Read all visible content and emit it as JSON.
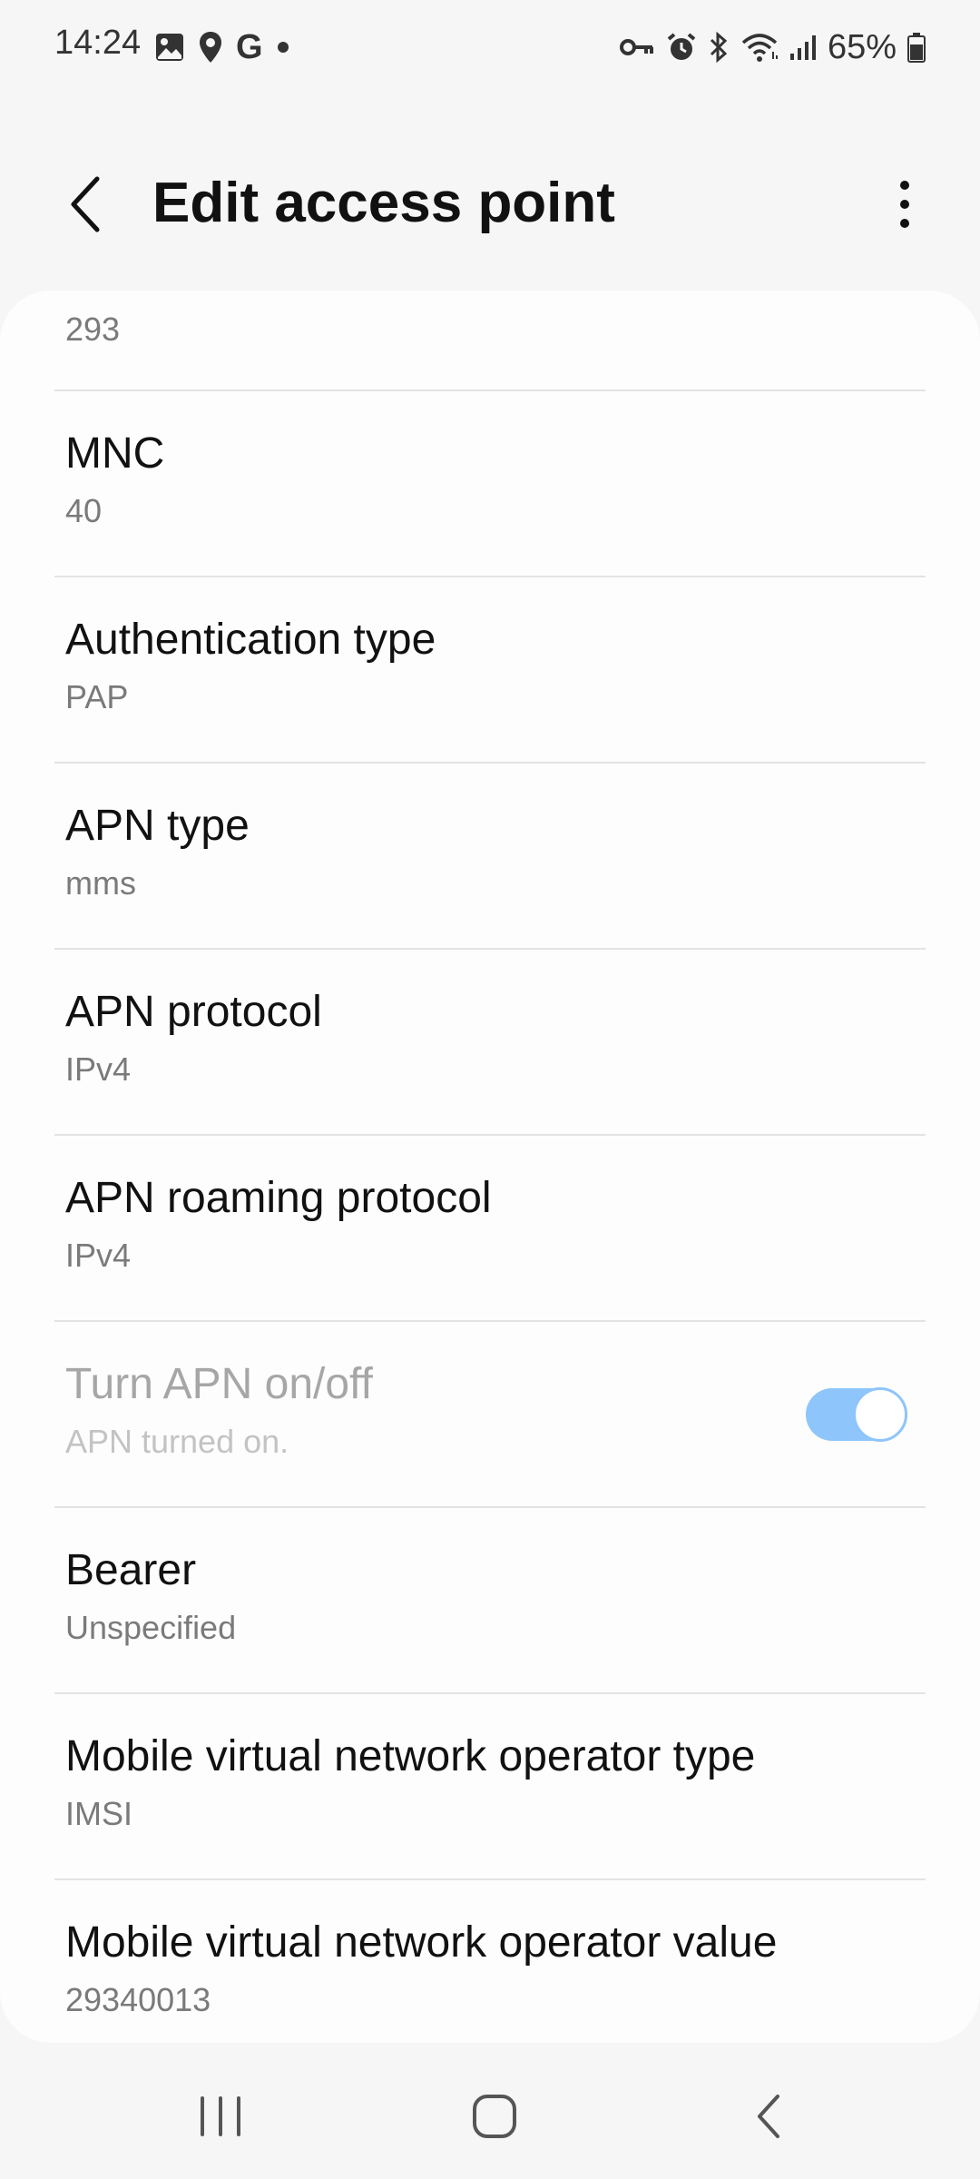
{
  "status_bar": {
    "time": "14:24",
    "left_icons": [
      "gallery-icon",
      "location-icon",
      "google-icon",
      "dot-icon"
    ],
    "google_letter": "G",
    "right_icons": [
      "vpn-key-icon",
      "alarm-icon",
      "bluetooth-icon",
      "wifi-icon",
      "signal-icon",
      "battery-icon"
    ],
    "battery_percent": "65%"
  },
  "header": {
    "title": "Edit access point"
  },
  "settings": {
    "partial_value": "293",
    "items": [
      {
        "title": "MNC",
        "value": "40"
      },
      {
        "title": "Authentication type",
        "value": "PAP"
      },
      {
        "title": "APN type",
        "value": "mms"
      },
      {
        "title": "APN protocol",
        "value": "IPv4"
      },
      {
        "title": "APN roaming protocol",
        "value": "IPv4"
      },
      {
        "title": "Turn APN on/off",
        "value": "APN turned on.",
        "toggle_on": true,
        "disabled": true
      },
      {
        "title": "Bearer",
        "value": "Unspecified"
      },
      {
        "title": "Mobile virtual network operator type",
        "value": "IMSI"
      },
      {
        "title": "Mobile virtual network operator value",
        "value": "29340013"
      }
    ]
  },
  "nav_bar": {
    "buttons": [
      "recents-icon",
      "home-icon",
      "back-icon"
    ]
  },
  "colors": {
    "background": "#f6f6f6",
    "card": "#fdfdfd",
    "toggle_accent": "#8ec5fb",
    "secondary_text": "#7a7a7a"
  }
}
